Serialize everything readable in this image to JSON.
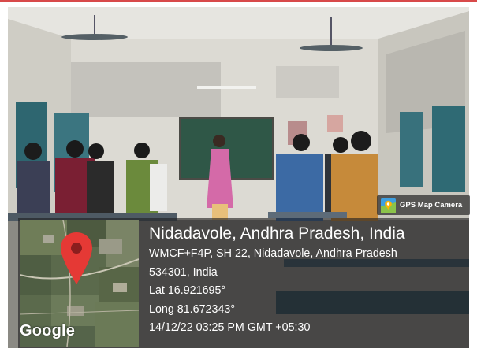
{
  "badge": {
    "text": "GPS Map Camera",
    "icon": "gps-map-camera-app-icon"
  },
  "location": {
    "title": "Nidadavole, Andhra Pradesh, India",
    "address_line1": "WMCF+F4P, SH 22, Nidadavole, Andhra Pradesh",
    "address_line2": "534301, India",
    "latitude": "Lat 16.921695°",
    "longitude": "Long 81.672343°",
    "timestamp": "14/12/22 03:25 PM GMT +05:30"
  },
  "map": {
    "attribution": "Google",
    "pin_icon": "map-pin-icon",
    "pin_color": "#e53935"
  },
  "colors": {
    "frame_accent": "#d84a4a",
    "chalkboard": "#2f5747",
    "overlay": "#1e1e20"
  }
}
